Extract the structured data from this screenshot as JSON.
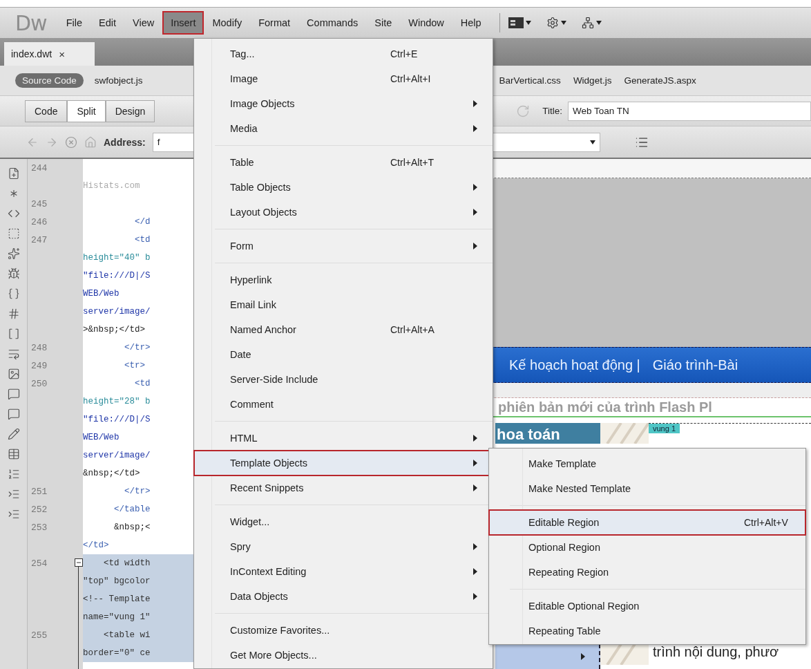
{
  "menu_bar": {
    "logo": "Dw",
    "items": [
      {
        "label": "File",
        "selected": false
      },
      {
        "label": "Edit",
        "selected": false
      },
      {
        "label": "View",
        "selected": false
      },
      {
        "label": "Insert",
        "selected": true
      },
      {
        "label": "Modify",
        "selected": false
      },
      {
        "label": "Format",
        "selected": false
      },
      {
        "label": "Commands",
        "selected": false
      },
      {
        "label": "Site",
        "selected": false
      },
      {
        "label": "Window",
        "selected": false
      },
      {
        "label": "Help",
        "selected": false
      }
    ]
  },
  "document_tabs": [
    {
      "label": "index.dwt",
      "close": "×",
      "selected": true
    }
  ],
  "related_files_start": [
    {
      "label": "Source Code",
      "selected": true
    },
    {
      "label": "swfobject.js",
      "selected": false
    }
  ],
  "related_files_end": [
    {
      "label": "BarVertical.css",
      "selected": false
    },
    {
      "label": "Widget.js",
      "selected": false
    },
    {
      "label": "GenerateJS.aspx",
      "selected": false
    }
  ],
  "view_buttons": [
    {
      "label": "Code",
      "selected": false
    },
    {
      "label": "Split",
      "selected": true
    },
    {
      "label": "Design",
      "selected": false
    }
  ],
  "title_field": {
    "label": "Title:",
    "value": "Web Toan TN"
  },
  "address_field": {
    "label": "Address:",
    "value": "f"
  },
  "code_view": {
    "lines": [
      {
        "number": "244",
        "kind": "plain",
        "selected": false
      },
      {
        "text": "Histats.com",
        "kind": "comment",
        "selected": false
      },
      {
        "number": "245",
        "kind": "plain",
        "selected": false
      },
      {
        "number": "246",
        "text": "          </d",
        "kind": "tag",
        "selected": false
      },
      {
        "number": "247",
        "text": "          <td",
        "kind": "tag",
        "selected": false
      },
      {
        "text": "height=\"40\" b",
        "kind": "attr",
        "selected": false
      },
      {
        "text": "\"file:///D|/S",
        "kind": "string",
        "selected": false
      },
      {
        "text": "WEB/Web",
        "kind": "string",
        "selected": false
      },
      {
        "text": "server/image/",
        "kind": "string",
        "selected": false
      },
      {
        "text": ">&nbsp;</td>",
        "kind": "entity",
        "selected": false
      },
      {
        "number": "248",
        "text": "        </tr>",
        "kind": "tag",
        "selected": false
      },
      {
        "number": "249",
        "text": "        <tr>",
        "kind": "tag",
        "selected": false
      },
      {
        "number": "250",
        "text": "          <td",
        "kind": "tag",
        "selected": false
      },
      {
        "text": "height=\"28\" b",
        "kind": "attr",
        "selected": false
      },
      {
        "text": "\"file:///D|/S",
        "kind": "string",
        "selected": false
      },
      {
        "text": "WEB/Web",
        "kind": "string",
        "selected": false
      },
      {
        "text": "server/image/",
        "kind": "string",
        "selected": false
      },
      {
        "text": "&nbsp;</td>",
        "kind": "entity",
        "selected": false
      },
      {
        "number": "251",
        "text": "        </tr>",
        "kind": "tag",
        "selected": false
      },
      {
        "number": "252",
        "text": "      </table",
        "kind": "tag",
        "selected": false
      },
      {
        "number": "253",
        "text": "      &nbsp;<",
        "kind": "entity",
        "selected": false
      },
      {
        "text": "</td>",
        "kind": "tag",
        "selected": false
      },
      {
        "number": "254",
        "text": "    <td width",
        "kind": "plain",
        "selected": true,
        "fold": true
      },
      {
        "text": "\"top\" bgcolor",
        "kind": "plain",
        "selected": true
      },
      {
        "text": "<!-- Template",
        "kind": "plain",
        "selected": true
      },
      {
        "text": "name=\"vung 1\"",
        "kind": "plain",
        "selected": true
      },
      {
        "number": "255",
        "text": "    <table wi",
        "kind": "plain",
        "selected": true
      },
      {
        "text": "border=\"0\" ce",
        "kind": "plain",
        "selected": true
      }
    ]
  },
  "design_view": {
    "nav_links": [
      "Kế hoạch hoạt động |",
      "Giáo trình-Bài"
    ],
    "marquee_text": "phiên bản mới của trình Flash Pl",
    "sidebar_heading": "hoa toán",
    "region_label": "vung 1",
    "body_text": "trình nội dung, phươ"
  },
  "insert_menu": {
    "items": [
      {
        "kind": "item",
        "label": "Tag...",
        "shortcut": "Ctrl+E",
        "submenu": false,
        "selected": false
      },
      {
        "kind": "item",
        "label": "Image",
        "shortcut": "Ctrl+Alt+I",
        "submenu": false,
        "selected": false
      },
      {
        "kind": "item",
        "label": "Image Objects",
        "submenu": true,
        "selected": false
      },
      {
        "kind": "item",
        "label": "Media",
        "submenu": true,
        "selected": false
      },
      {
        "kind": "separator"
      },
      {
        "kind": "item",
        "label": "Table",
        "shortcut": "Ctrl+Alt+T",
        "submenu": false,
        "selected": false
      },
      {
        "kind": "item",
        "label": "Table Objects",
        "submenu": true,
        "selected": false
      },
      {
        "kind": "item",
        "label": "Layout Objects",
        "submenu": true,
        "selected": false
      },
      {
        "kind": "separator"
      },
      {
        "kind": "item",
        "label": "Form",
        "submenu": true,
        "selected": false
      },
      {
        "kind": "separator"
      },
      {
        "kind": "item",
        "label": "Hyperlink",
        "submenu": false,
        "selected": false
      },
      {
        "kind": "item",
        "label": "Email Link",
        "submenu": false,
        "selected": false
      },
      {
        "kind": "item",
        "label": "Named Anchor",
        "shortcut": "Ctrl+Alt+A",
        "submenu": false,
        "selected": false
      },
      {
        "kind": "item",
        "label": "Date",
        "submenu": false,
        "selected": false
      },
      {
        "kind": "item",
        "label": "Server-Side Include",
        "submenu": false,
        "selected": false
      },
      {
        "kind": "item",
        "label": "Comment",
        "submenu": false,
        "selected": false
      },
      {
        "kind": "separator"
      },
      {
        "kind": "item",
        "label": "HTML",
        "submenu": true,
        "selected": false
      },
      {
        "kind": "item",
        "label": "Template Objects",
        "submenu": true,
        "selected": true
      },
      {
        "kind": "item",
        "label": "Recent Snippets",
        "submenu": true,
        "selected": false
      },
      {
        "kind": "separator"
      },
      {
        "kind": "item",
        "label": "Widget...",
        "submenu": false,
        "selected": false
      },
      {
        "kind": "item",
        "label": "Spry",
        "submenu": true,
        "selected": false
      },
      {
        "kind": "item",
        "label": "InContext Editing",
        "submenu": true,
        "selected": false
      },
      {
        "kind": "item",
        "label": "Data Objects",
        "submenu": true,
        "selected": false
      },
      {
        "kind": "separator"
      },
      {
        "kind": "item",
        "label": "Customize Favorites...",
        "submenu": false,
        "selected": false
      },
      {
        "kind": "item",
        "label": "Get More Objects...",
        "submenu": false,
        "selected": false
      }
    ]
  },
  "template_submenu": {
    "items": [
      {
        "kind": "item",
        "label": "Make Template",
        "selected": false
      },
      {
        "kind": "item",
        "label": "Make Nested Template",
        "selected": false
      },
      {
        "kind": "separator"
      },
      {
        "kind": "item",
        "label": "Editable Region",
        "shortcut": "Ctrl+Alt+V",
        "selected": true
      },
      {
        "kind": "item",
        "label": "Optional Region",
        "selected": false
      },
      {
        "kind": "item",
        "label": "Repeating Region",
        "selected": false
      },
      {
        "kind": "separator"
      },
      {
        "kind": "item",
        "label": "Editable Optional Region",
        "selected": false
      },
      {
        "kind": "item",
        "label": "Repeating Table",
        "selected": false
      }
    ]
  }
}
